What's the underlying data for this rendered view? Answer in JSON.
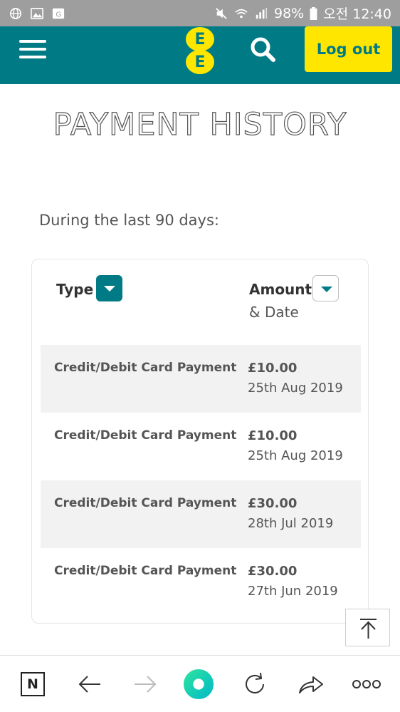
{
  "status_bar": {
    "battery": "98%",
    "time": "오전 12:40"
  },
  "header": {
    "logo_letter": "E",
    "logout_label": "Log out"
  },
  "page": {
    "title": "PAYMENT HISTORY",
    "subtitle": "During the last 90 days:"
  },
  "table": {
    "col_type": "Type",
    "col_amount": "Amount",
    "col_date": "& Date",
    "rows": [
      {
        "type": "Credit/Debit Card Payment",
        "amount": "£10.00",
        "date": "25th Aug 2019"
      },
      {
        "type": "Credit/Debit Card Payment",
        "amount": "£10.00",
        "date": "25th Aug 2019"
      },
      {
        "type": "Credit/Debit Card Payment",
        "amount": "£30.00",
        "date": "28th Jul 2019"
      },
      {
        "type": "Credit/Debit Card Payment",
        "amount": "£30.00",
        "date": "27th Jun 2019"
      }
    ]
  },
  "browser_bar": {
    "n_label": "N"
  },
  "colors": {
    "brand_teal": "#007b85",
    "brand_yellow": "#ffe600"
  }
}
